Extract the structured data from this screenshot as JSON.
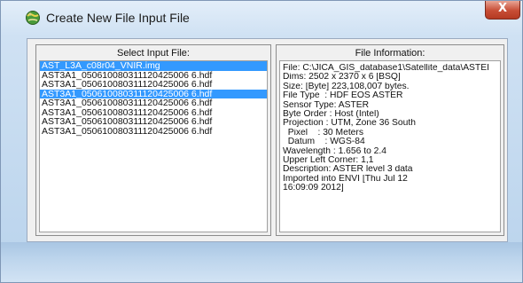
{
  "window": {
    "title": "Create New File Input File",
    "close_glyph": "X",
    "icon": "envi-globe-icon"
  },
  "left_panel": {
    "header": "Select Input File:",
    "files": [
      {
        "name": "AST_L3A_c08r04_VNIR.img",
        "selected": true
      },
      {
        "name": "AST3A1_050610080311120425006 6.hdf",
        "selected": false
      },
      {
        "name": "AST3A1_050610080311120425006 6.hdf",
        "selected": false
      },
      {
        "name": "AST3A1_050610080311120425006 6.hdf",
        "selected": true
      },
      {
        "name": "AST3A1_050610080311120425006 6.hdf",
        "selected": false
      },
      {
        "name": "AST3A1_050610080311120425006 6.hdf",
        "selected": false
      },
      {
        "name": "AST3A1_050610080311120425006 6.hdf",
        "selected": false
      },
      {
        "name": "AST3A1_050610080311120425006 6.hdf",
        "selected": false
      }
    ]
  },
  "right_panel": {
    "header": "File Information:",
    "lines": [
      "File: C:\\JICA_GIS_database1\\Satellite_data\\ASTEI",
      "Dims: 2502 x 2370 x 6 [BSQ]",
      "Size: [Byte] 223,108,007 bytes.",
      "File Type  : HDF EOS ASTER",
      "Sensor Type: ASTER",
      "Byte Order : Host (Intel)",
      "Projection : UTM, Zone 36 South",
      "  Pixel    : 30 Meters",
      "  Datum    : WGS-84",
      "Wavelength : 1.656 to 2.4",
      "Upper Left Corner: 1,1",
      "Description: ASTER level 3 data",
      "Imported into ENVI [Thu Jul 12",
      "16:09:09 2012]"
    ]
  },
  "colors": {
    "selection": "#3399ff",
    "close_button": "#c74d35"
  }
}
